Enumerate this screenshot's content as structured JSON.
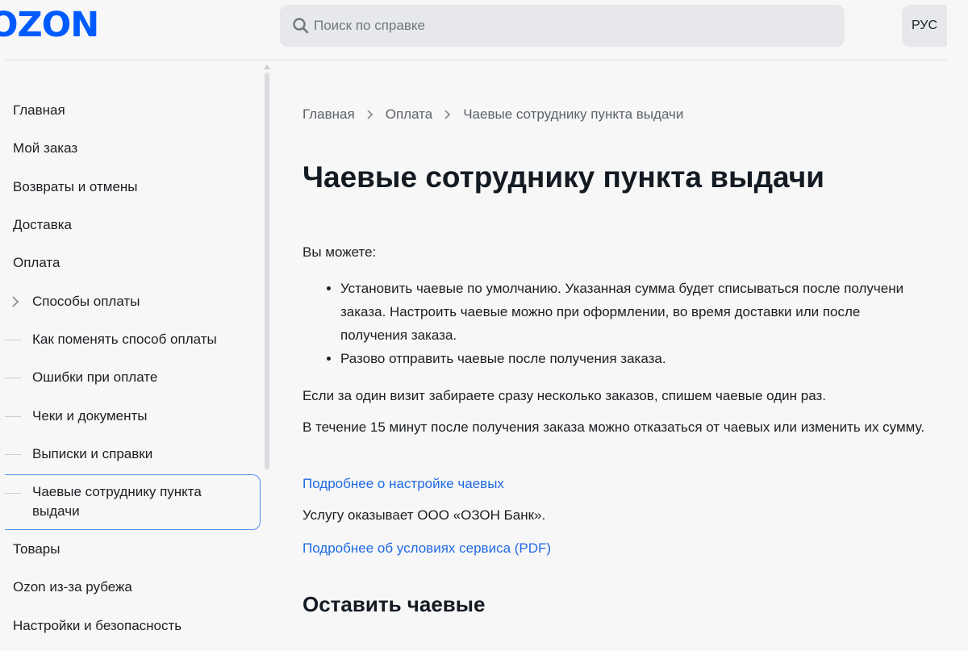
{
  "header": {
    "logo": "OZON",
    "search_placeholder": "Поиск по справке",
    "language": "РУС"
  },
  "sidebar": {
    "items": [
      {
        "label": "Главная"
      },
      {
        "label": "Мой заказ"
      },
      {
        "label": "Возвраты и отмены"
      },
      {
        "label": "Доставка"
      },
      {
        "label": "Оплата"
      }
    ],
    "subitems": [
      {
        "label": "Способы оплаты",
        "marker": "chevron-right-icon"
      },
      {
        "label": "Как поменять способ оплаты",
        "marker": "dash"
      },
      {
        "label": "Ошибки при оплате",
        "marker": "dash"
      },
      {
        "label": "Чеки и документы",
        "marker": "dash"
      },
      {
        "label": "Выписки и справки",
        "marker": "dash"
      }
    ],
    "active": {
      "label": "Чаевые сотруднику пункта выдачи"
    },
    "items_after": [
      {
        "label": "Товары"
      },
      {
        "label": "Ozon из-за рубежа"
      },
      {
        "label": "Настройки и безопасность"
      }
    ]
  },
  "breadcrumb": [
    "Главная",
    "Оплата",
    "Чаевые сотруднику пункта выдачи"
  ],
  "main": {
    "title": "Чаевые сотруднику пункта выдачи",
    "intro": "Вы можете:",
    "bullets": [
      "Установить чаевые по умолчанию. Указанная сумма будет списываться после получени\nзаказа. Настроить чаевые можно при оформлении, во время доставки или после\nполучения заказа.",
      "Разово отправить чаевые после получения заказа."
    ],
    "p1": "Если за один визит забираете сразу несколько заказов, спишем чаевые один раз.",
    "p2": "В течение 15 минут после получения заказа можно отказаться от чаевых или изменить их сумму.",
    "link1": "Подробнее о настройке чаевых",
    "p3": "Услугу оказывает ООО «ОЗОН Банк».",
    "link2": "Подробнее об условиях сервиса (PDF)",
    "section_title": "Оставить чаевые"
  },
  "colors": {
    "brand": "#005bff",
    "link": "#1f6ae6",
    "active_border": "#4b8ff5",
    "background": "#f7f7f7"
  }
}
